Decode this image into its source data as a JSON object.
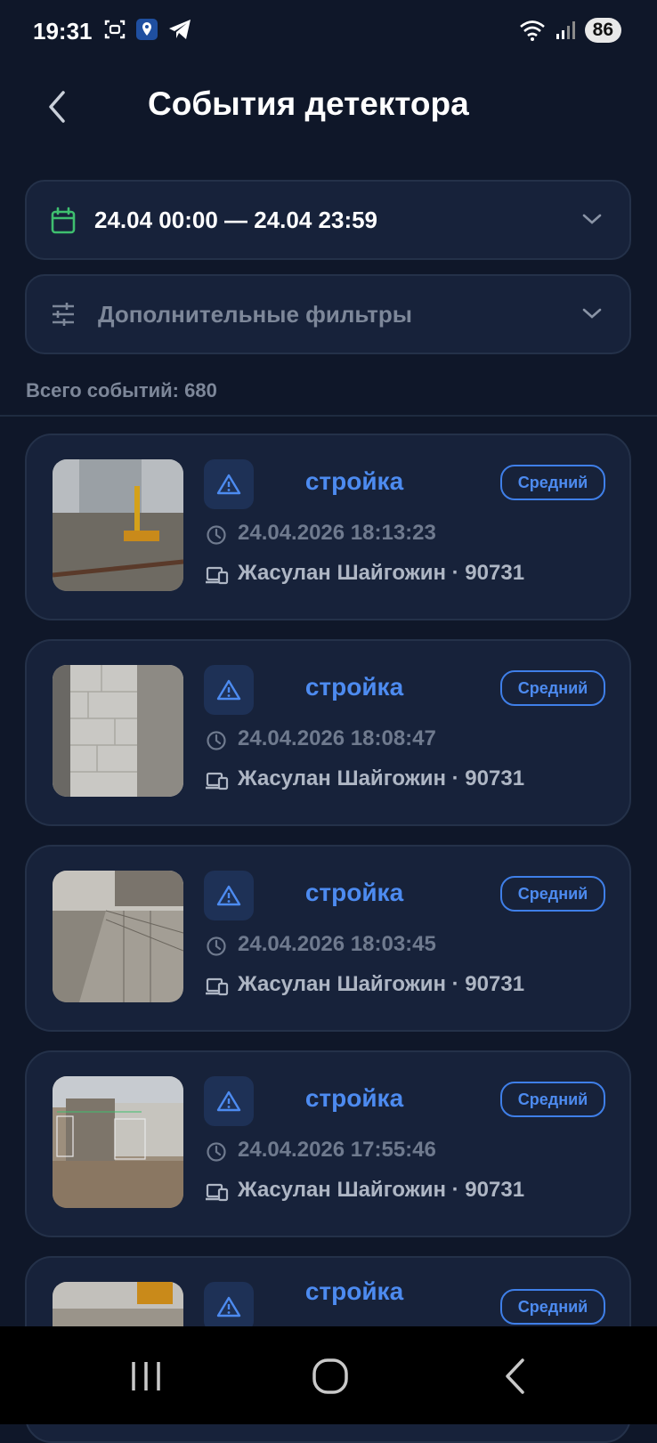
{
  "status_bar": {
    "time": "19:31",
    "battery": "86",
    "icons": [
      "screenshot-icon",
      "location-app-icon",
      "telegram-icon",
      "wifi-icon",
      "signal-icon"
    ]
  },
  "header": {
    "title": "События детектора",
    "back_icon": "chevron-left-icon"
  },
  "date_filter": {
    "label": "24.04 00:00 — 24.04 23:59",
    "icon": "calendar-icon",
    "accent": "#3fbf6f"
  },
  "extra_filters": {
    "label": "Дополнительные фильтры",
    "icon": "sliders-icon"
  },
  "total": "Всего событий: 680",
  "events": [
    {
      "title": "стройка",
      "severity": "Средний",
      "timestamp": "24.04.2026 18:13:23",
      "device": "Жасулан Шайгожин · 90731"
    },
    {
      "title": "стройка",
      "severity": "Средний",
      "timestamp": "24.04.2026 18:08:47",
      "device": "Жасулан Шайгожин · 90731"
    },
    {
      "title": "стройка",
      "severity": "Средний",
      "timestamp": "24.04.2026 18:03:45",
      "device": "Жасулан Шайгожин · 90731"
    },
    {
      "title": "стройка",
      "severity": "Средний",
      "timestamp": "24.04.2026 17:55:46",
      "device": "Жасулан Шайгожин · 90731"
    },
    {
      "title": "стройка",
      "severity": "Средний"
    }
  ],
  "colors": {
    "background": "#0f1729",
    "card": "#17223a",
    "accent_blue": "#4d8bf0",
    "muted_text": "#7d8799"
  },
  "nav": {
    "recent_icon": "recent-apps-icon",
    "home_icon": "home-icon",
    "back_icon": "nav-back-icon"
  }
}
